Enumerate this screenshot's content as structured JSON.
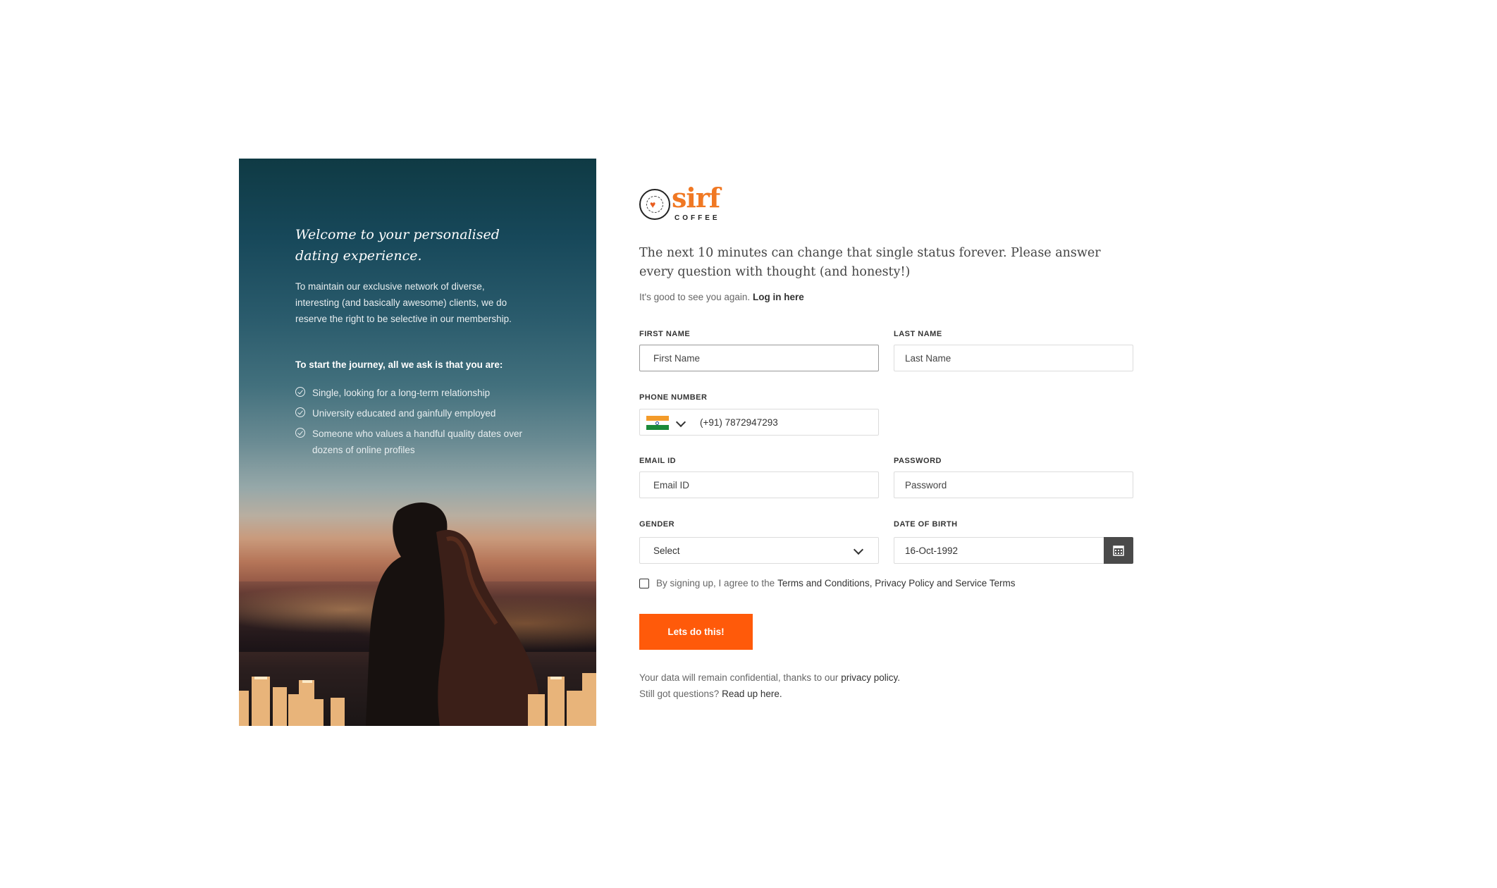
{
  "hero": {
    "title": "Welcome to your personalised dating experience.",
    "description": "To maintain our exclusive network of diverse, interesting (and basically awesome) clients, we do reserve the right to be selective in our membership.",
    "ask": "To start the journey, all we ask is that you are:",
    "items": [
      {
        "label": "Single, looking for a long-term relationship"
      },
      {
        "label": "University educated and gainfully employed"
      },
      {
        "label": "Someone who values a handful quality dates over dozens of online profiles"
      }
    ]
  },
  "brand": {
    "name": "sirf",
    "sub": "COFFEE",
    "accent": "#f07823"
  },
  "form": {
    "tagline": "The next 10 minutes can change that single status forever. Please answer every question with thought (and honesty!)",
    "login_prompt": "It's good to see you again.",
    "login_link": "Log in here",
    "first_name": {
      "label": "FIRST  NAME",
      "placeholder": "First Name"
    },
    "last_name": {
      "label": "LAST  NAME",
      "placeholder": "Last Name"
    },
    "phone": {
      "label": "PHONE NUMBER",
      "value": "(+91) 7872947293",
      "country_icon": "india-flag-icon"
    },
    "email": {
      "label": "EMAIL ID",
      "placeholder": "Email ID"
    },
    "password": {
      "label": "PASSWORD",
      "placeholder": "Password"
    },
    "gender": {
      "label": "GENDER",
      "value": "Select"
    },
    "dob": {
      "label": "DATE OF BIRTH",
      "value": "16-Oct-1992"
    },
    "agree_text": "By signing up, I agree to the",
    "agree_link": "Terms and Conditions, Privacy Policy and Service Terms",
    "submit": "Lets do this!",
    "submit_color": "#ff5a0a",
    "footer_line1": "Your data will remain confidential, thanks to our",
    "footer_link1": "privacy policy.",
    "footer_line2": "Still got questions?",
    "footer_link2": "Read up here."
  }
}
